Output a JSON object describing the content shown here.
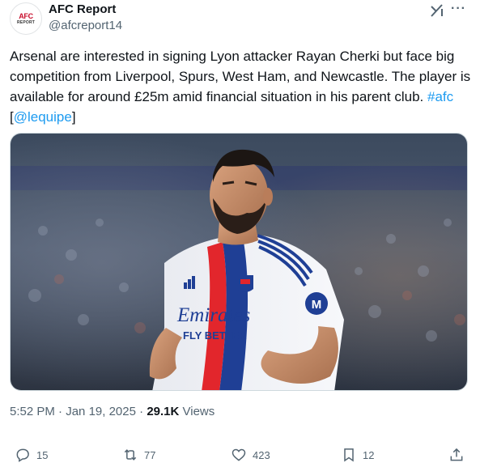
{
  "author": {
    "name": "AFC Report",
    "handle": "@afcreport14",
    "avatar_text_top": "AFC",
    "avatar_text_bottom": "REPORT"
  },
  "tweet": {
    "text_main": "Arsenal are interested in signing Lyon attacker Rayan Cherki but face big competition from Liverpool, Spurs, West Ham, and Newcastle. The player is available for around £25m amid financial situation in his parent club.",
    "hashtag": "#afc",
    "mention_open": "[",
    "mention": "@lequipe",
    "mention_close": "]"
  },
  "media": {
    "shirt_sponsor_line1": "Emirates",
    "shirt_sponsor_line2": "FLY BETTER",
    "sleeve_badge": "M"
  },
  "meta": {
    "time": "5:52 PM",
    "separator": "·",
    "date": "Jan 19, 2025",
    "views_count": "29.1K",
    "views_label": "Views"
  },
  "actions": {
    "replies": "15",
    "reposts": "77",
    "likes": "423",
    "bookmarks": "12"
  },
  "icons": [
    "grok-icon",
    "more-icon",
    "reply-icon",
    "repost-icon",
    "like-icon",
    "bookmark-icon",
    "share-icon"
  ],
  "colors": {
    "link": "#1d9bf0",
    "secondary_text": "#536471",
    "primary_text": "#0f1419"
  }
}
